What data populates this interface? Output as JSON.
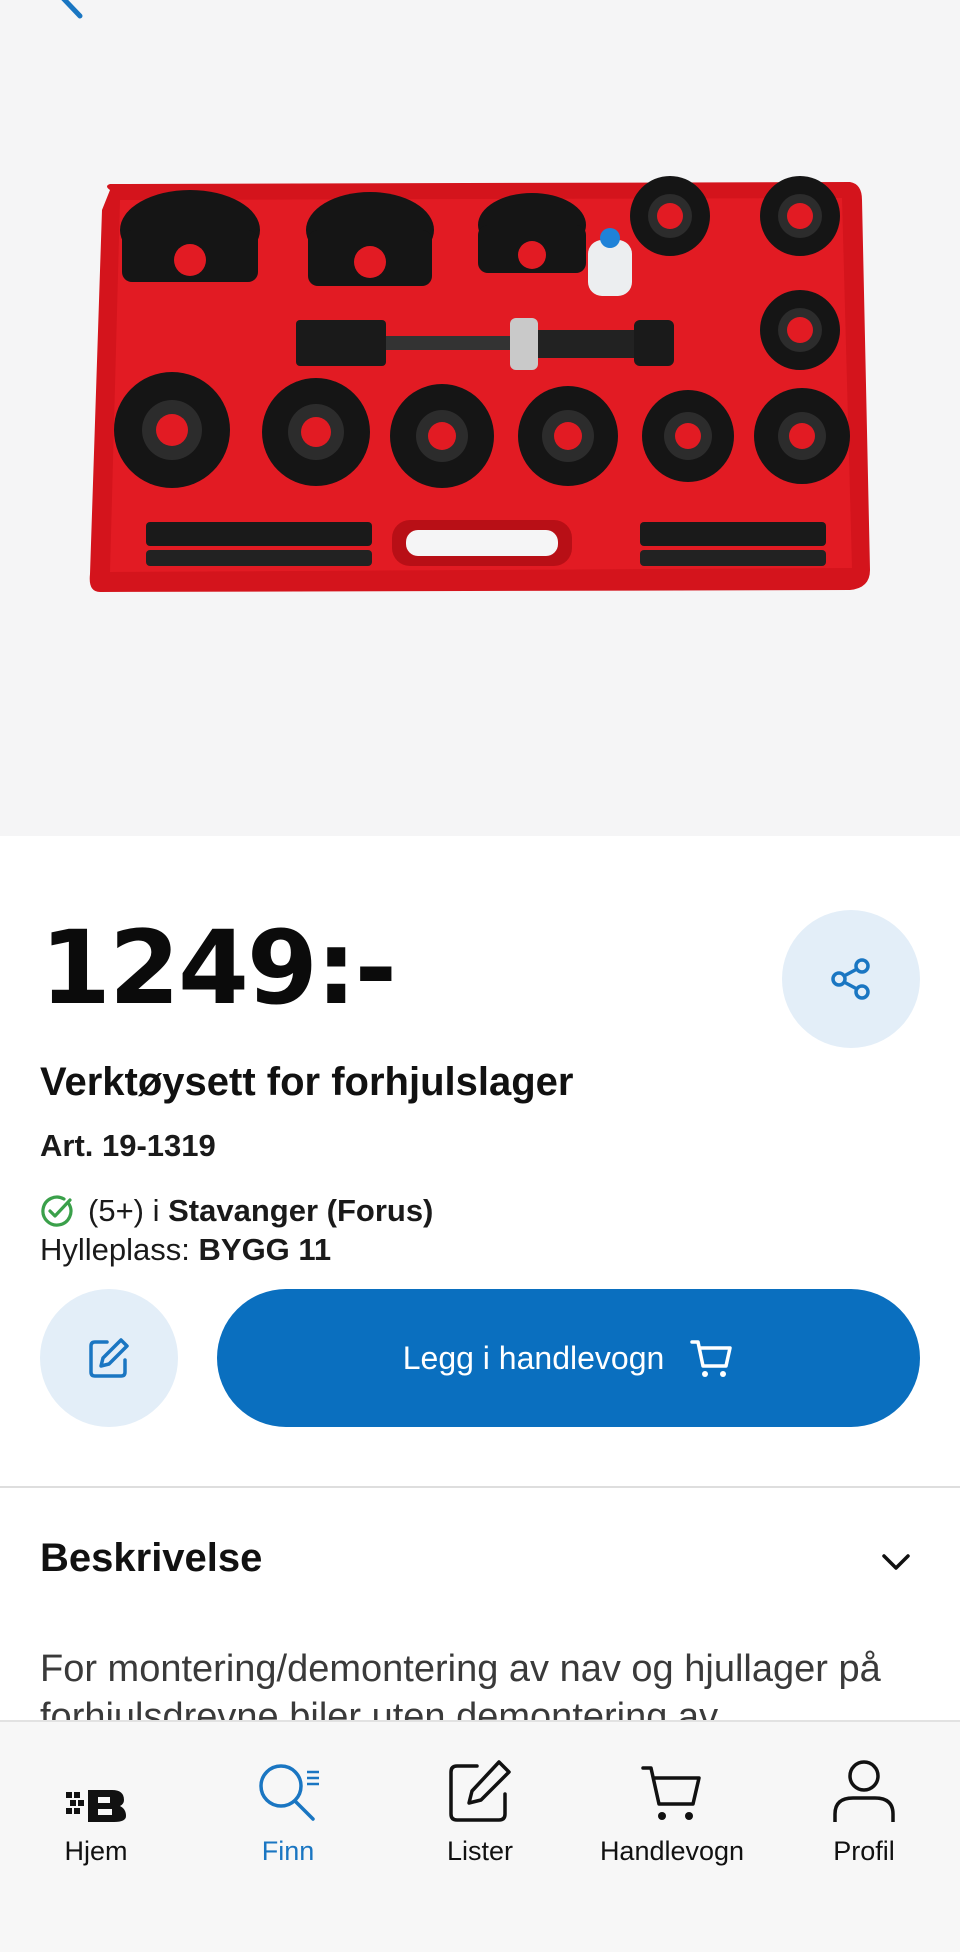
{
  "product": {
    "price": "1249:-",
    "title": "Verktøysett for forhjulslager",
    "article": "Art. 19-1319",
    "stock_count": "(5+) i ",
    "store": "Stavanger (Forus)",
    "shelf_label": "Hylleplass: ",
    "shelf_value": "BYGG 11",
    "image_icon": "bearing-tool-kit-red-case"
  },
  "actions": {
    "add_to_cart_label": "Legg i handlevogn",
    "share_icon": "share-icon",
    "edit_icon": "edit-icon"
  },
  "description": {
    "heading": "Beskrivelse",
    "text": "For montering/demontering av nav og hjullager på forhjulsdrevne biler uten demontering av"
  },
  "tabbar": {
    "items": [
      {
        "label": "Hjem",
        "icon": "home-logo-icon"
      },
      {
        "label": "Finn",
        "icon": "search-icon",
        "active": true
      },
      {
        "label": "Lister",
        "icon": "edit-list-icon"
      },
      {
        "label": "Handlevogn",
        "icon": "cart-icon"
      },
      {
        "label": "Profil",
        "icon": "profile-icon"
      }
    ]
  },
  "colors": {
    "accent": "#0a6fbf",
    "accent_light": "#e3eef8",
    "stock_ok": "#3aa04a",
    "case_red": "#d4141c"
  }
}
